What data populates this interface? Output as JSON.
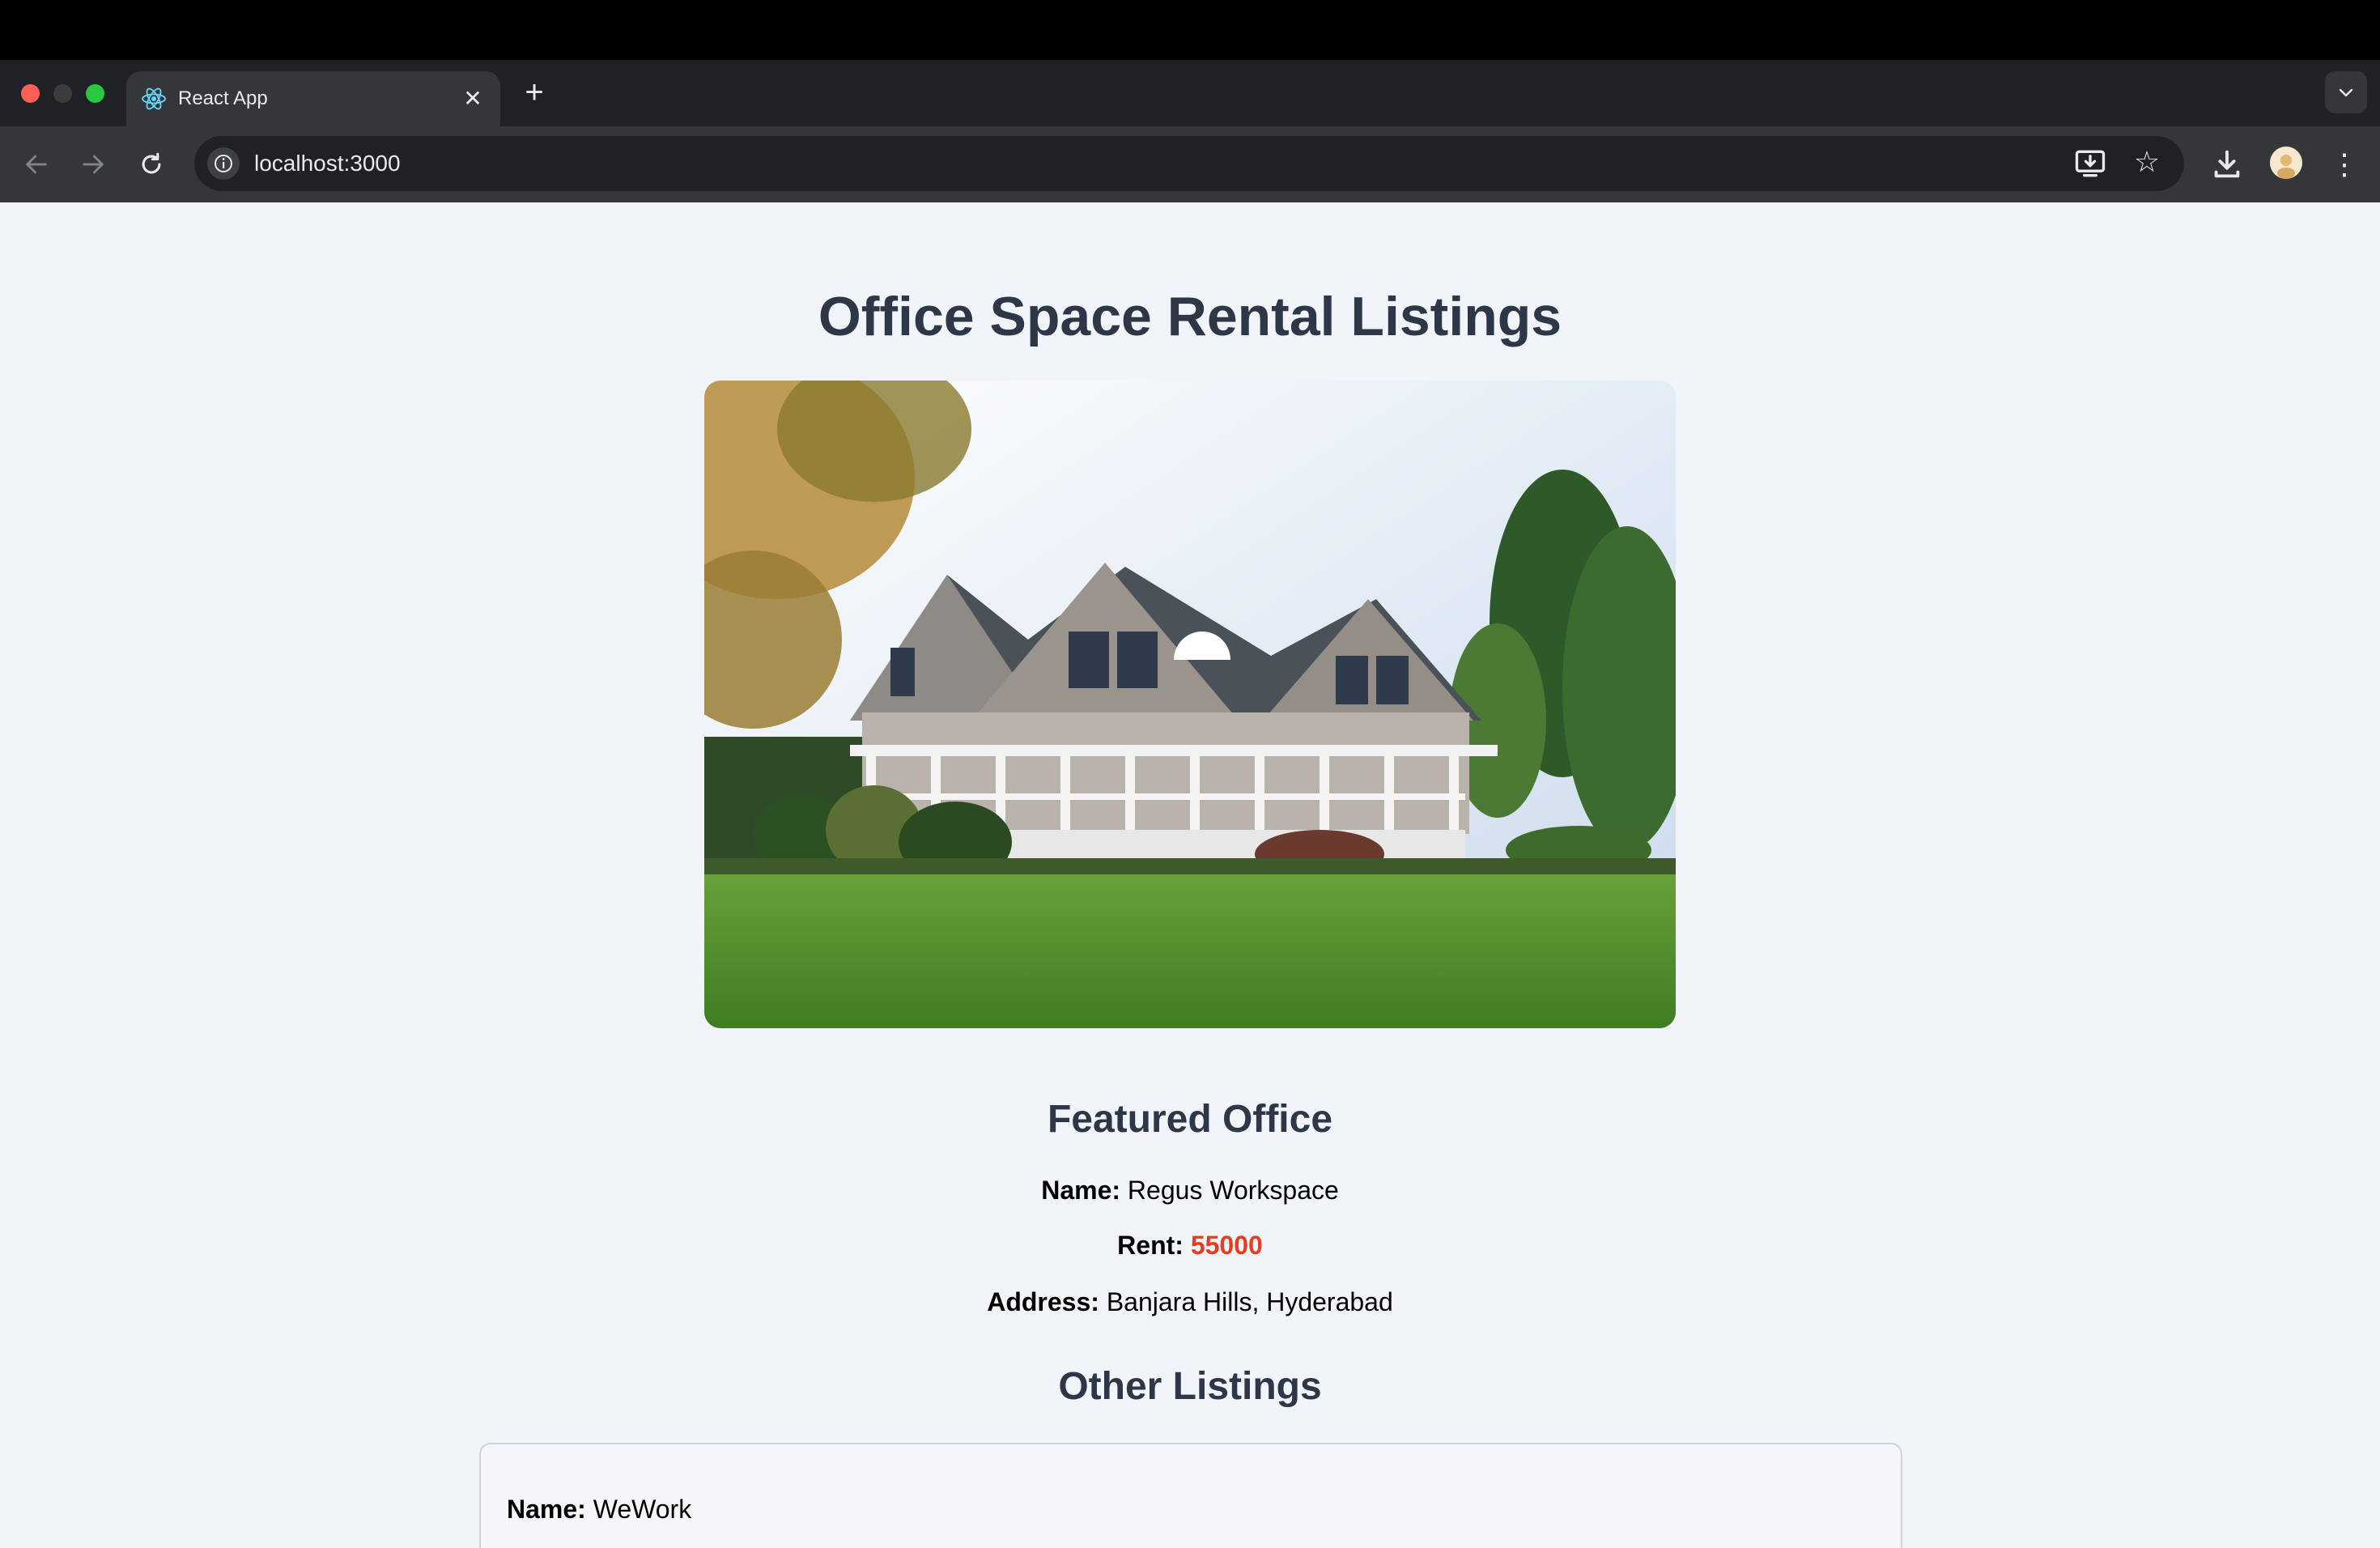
{
  "browser": {
    "tab": {
      "title": "React App",
      "close_glyph": "✕"
    },
    "new_tab_glyph": "+",
    "url": "localhost:3000",
    "icons": {
      "back": "arrow-left-icon",
      "forward": "arrow-right-icon",
      "reload": "reload-icon",
      "site_info": "info-icon",
      "install": "install-app-icon",
      "bookmark": "star-icon",
      "downloads": "download-icon",
      "menu": "kebab-menu-icon"
    }
  },
  "page": {
    "title": "Office Space Rental Listings",
    "hero_image": {
      "alt": "house-photo"
    },
    "featured": {
      "heading": "Featured Office",
      "name_label": "Name:",
      "name_value": "Regus Workspace",
      "rent_label": "Rent:",
      "rent_value": "55000",
      "address_label": "Address:",
      "address_value": "Banjara Hills, Hyderabad"
    },
    "other": {
      "heading": "Other Listings",
      "listings": [
        {
          "name_label": "Name:",
          "name_value": "WeWork"
        }
      ]
    }
  },
  "colors": {
    "heading": "#2d3748",
    "rent_highlight": "#e53e24",
    "page_bg": "#f1f4f8"
  }
}
